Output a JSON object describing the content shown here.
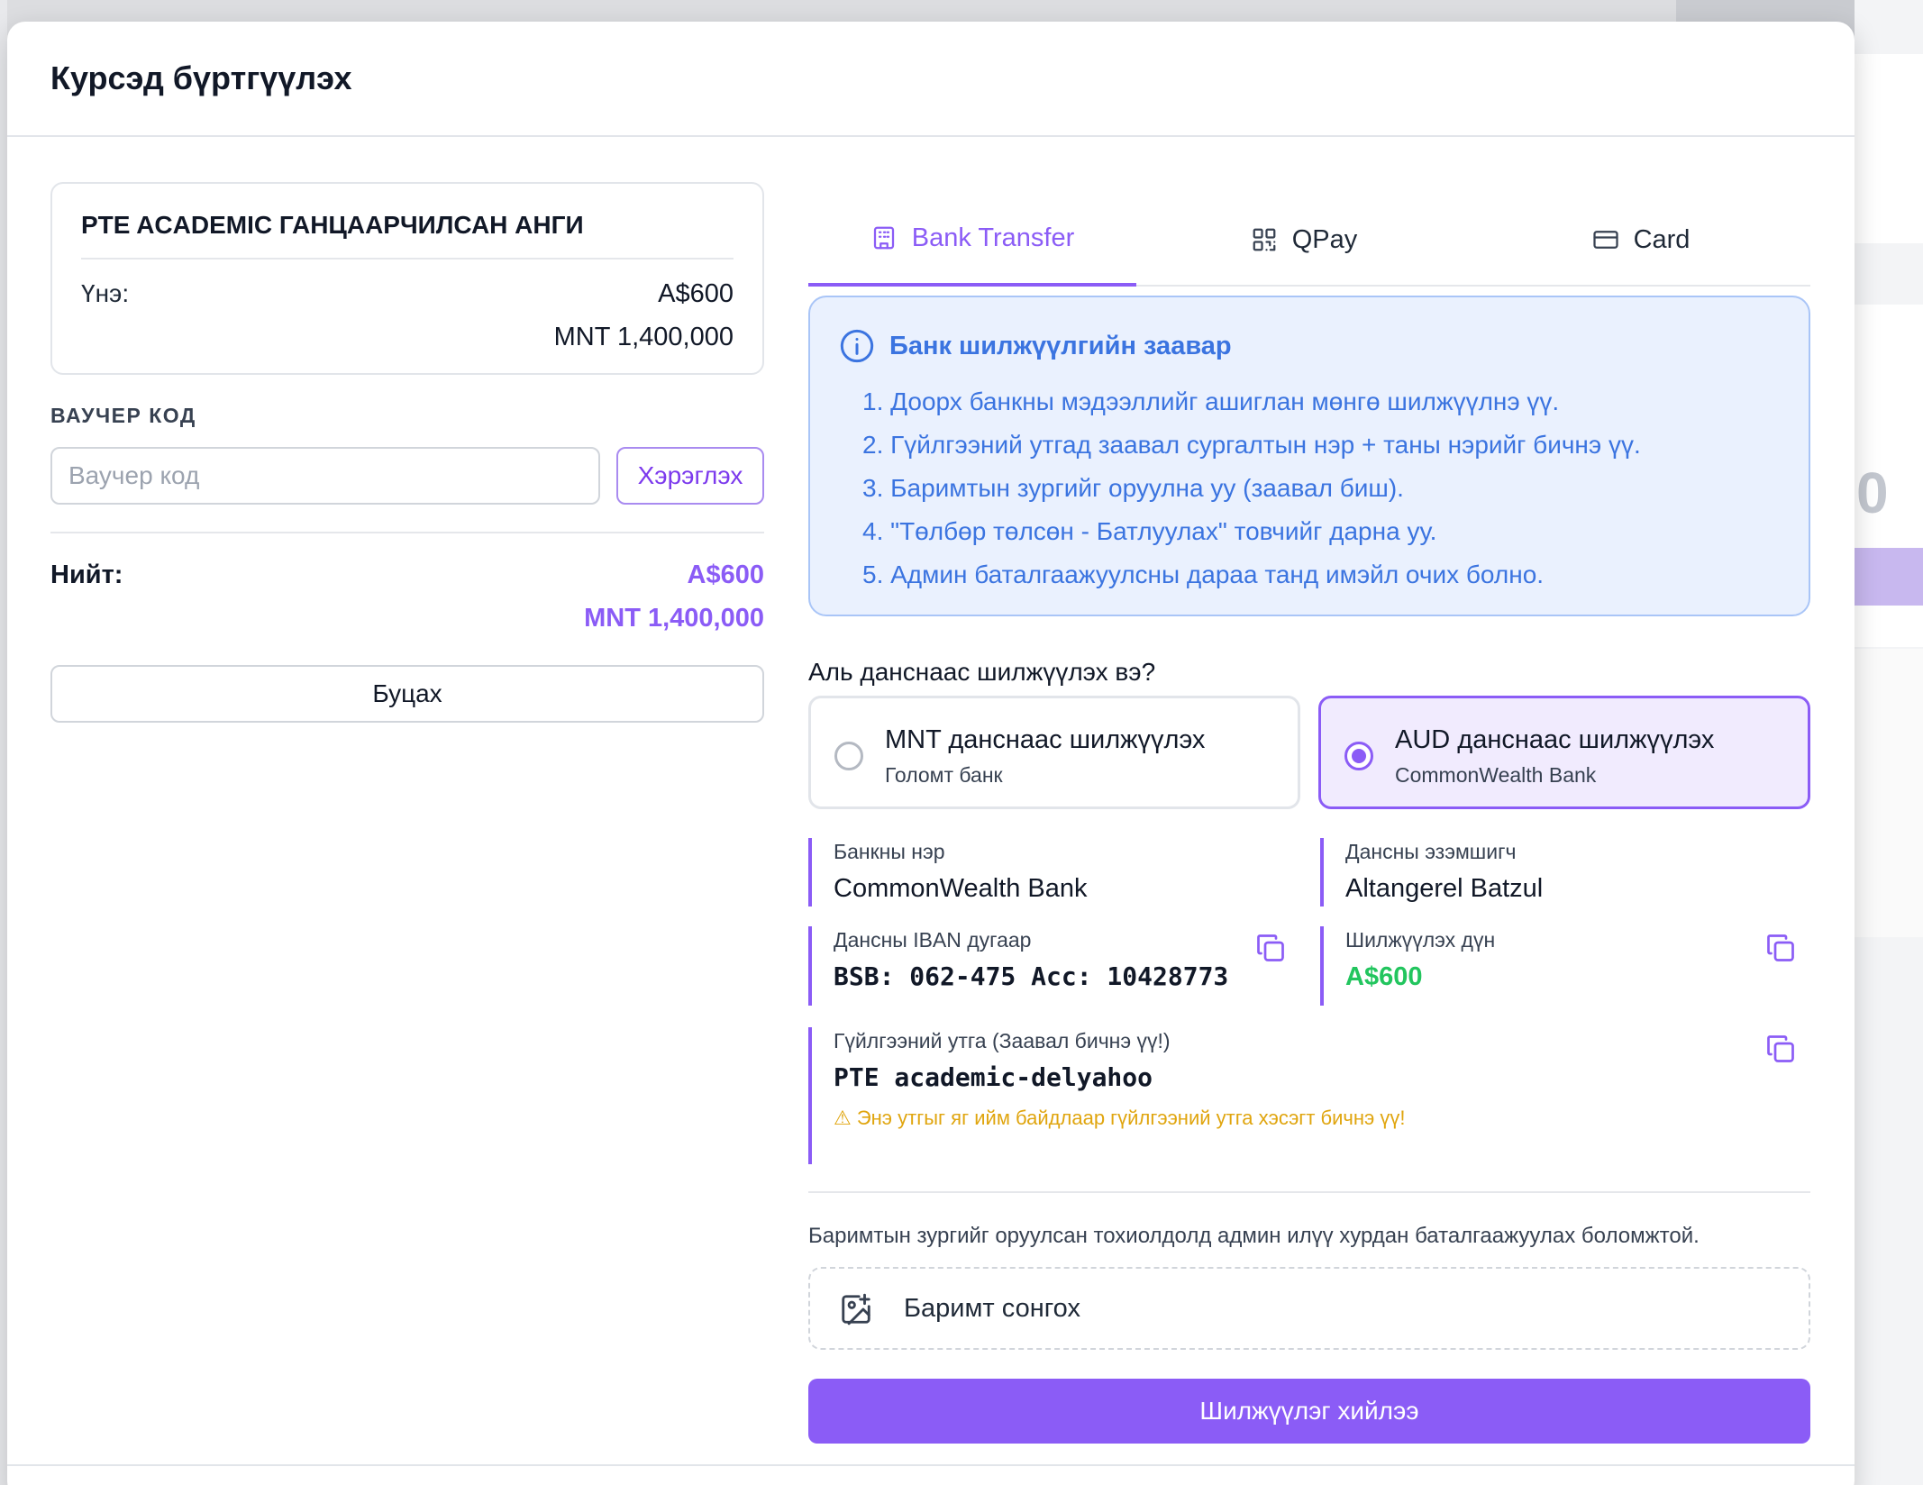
{
  "modal": {
    "title": "Курсэд бүртгүүлэх"
  },
  "course": {
    "title": "PTE ACADEMIC ГАНЦААРЧИЛСАН АНГИ",
    "price_label": "Үнэ:",
    "price_aud": "A$600",
    "price_mnt": "MNT 1,400,000"
  },
  "voucher": {
    "label": "ВАУЧЕР КОД",
    "placeholder": "Ваучер код",
    "value": "",
    "apply_label": "Хэрэглэх"
  },
  "total": {
    "label": "Нийт:",
    "aud": "A$600",
    "mnt": "MNT 1,400,000"
  },
  "back_label": "Буцах",
  "tabs": [
    {
      "label": "Bank Transfer",
      "icon": "bank-icon",
      "active": true
    },
    {
      "label": "QPay",
      "icon": "qr-code-icon",
      "active": false
    },
    {
      "label": "Card",
      "icon": "credit-card-icon",
      "active": false
    }
  ],
  "instructions": {
    "title": "Банк шилжүүлгийн заавар",
    "icon": "info-icon",
    "steps": [
      "1. Доорх банкны мэдээллийг ашиглан мөнгө шилжүүлнэ үү.",
      "2. Гүйлгээний утгад заавал сургалтын нэр + таны нэрийг бичнэ үү.",
      "3. Баримтын зургийг оруулна уу (заавал биш).",
      "4. \"Төлбөр төлсөн - Батлуулах\" товчийг дарна уу.",
      "5. Админ баталгаажуулсны дараа танд имэйл очих болно."
    ]
  },
  "account_select": {
    "question": "Аль данснаас шилжүүлэх вэ?",
    "options": [
      {
        "title": "MNT данснаас шилжүүлэх",
        "subtitle": "Голомт банк",
        "selected": false
      },
      {
        "title": "AUD данснаас шилжүүлэх",
        "subtitle": "CommonWealth Bank",
        "selected": true
      }
    ]
  },
  "bank_details": {
    "bank_name_label": "Банкны нэр",
    "bank_name": "CommonWealth Bank",
    "holder_label": "Дансны эзэмшигч",
    "holder": "Altangerel Batzul",
    "iban_label": "Дансны IBAN дугаар",
    "iban": "BSB: 062-475 Acc: 10428773",
    "amount_label": "Шилжүүлэх дүн",
    "amount": "A$600",
    "reference_label": "Гүйлгээний утга (Заавал бичнэ үү!)",
    "reference": "PTE academic-delyahoo",
    "reference_warning": "⚠ Энэ утгыг яг ийм байдлаар гүйлгээний утга хэсэгт бичнэ үү!"
  },
  "receipt": {
    "note": "Баримтын зургийг оруулсан тохиолдолд админ илүү хурдан баталгаажуулах боломжтой.",
    "upload_label": "Баримт сонгох"
  },
  "submit_label": "Шилжүүлэг хийлээ",
  "colors": {
    "accent": "#8b5cf6",
    "info_text": "#3b74e0",
    "info_bg": "#eaf1fe",
    "success": "#22c55e",
    "warning": "#e0a50e"
  },
  "background": {
    "partial_number": "0"
  }
}
